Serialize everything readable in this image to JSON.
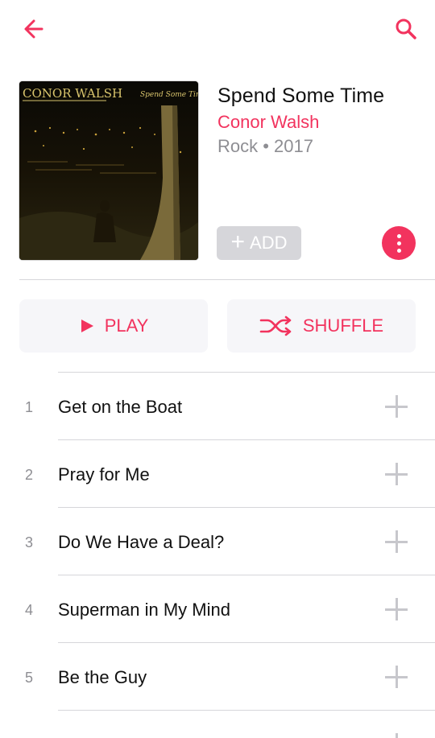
{
  "nav": {
    "back_icon": "arrow-left-icon",
    "search_icon": "search-icon"
  },
  "album": {
    "cover_artist_text": "CONOR WALSH",
    "cover_title_text": "Spend Some Time",
    "title": "Spend Some Time",
    "artist": "Conor Walsh",
    "meta": "Rock • 2017",
    "add_label": "ADD"
  },
  "actions": {
    "play_label": "PLAY",
    "shuffle_label": "SHUFFLE"
  },
  "tracks": [
    {
      "number": "1",
      "title": "Get on the Boat"
    },
    {
      "number": "2",
      "title": "Pray for Me"
    },
    {
      "number": "3",
      "title": "Do We Have a Deal?"
    },
    {
      "number": "4",
      "title": "Superman in My Mind"
    },
    {
      "number": "5",
      "title": "Be the Guy"
    }
  ],
  "colors": {
    "accent": "#f2335e",
    "secondary_text": "#8e8e93",
    "button_bg": "#f6f6f9",
    "divider": "#d6d6da"
  }
}
